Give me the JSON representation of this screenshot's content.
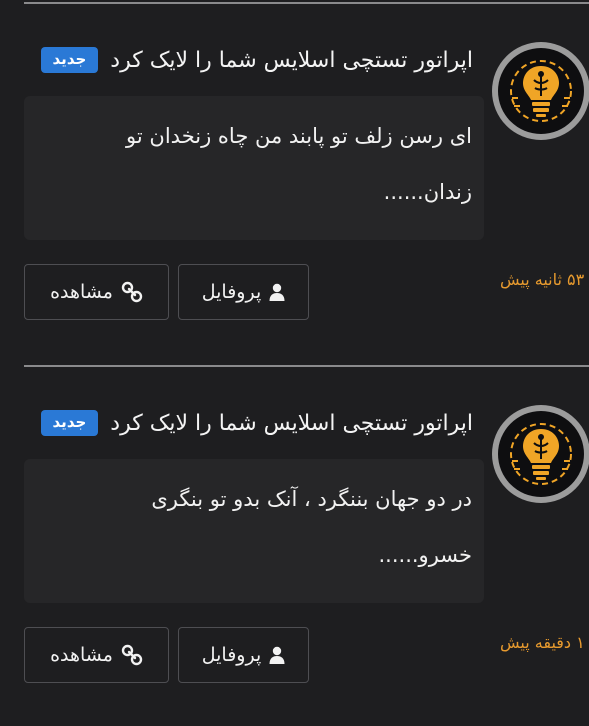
{
  "notifications": [
    {
      "title": "اپراتور تستچی اسلایس شما را لایک کرد",
      "badge": "جدید",
      "message_line1": "ای رسن زلف تو پابند من چاه زنخدان تو",
      "message_line2": "زندان......",
      "time": "۵۳ ثانیه پیش",
      "profile_label": "پروفایل",
      "view_label": "مشاهده",
      "avatar_icon": "lightbulb-brain-icon"
    },
    {
      "title": "اپراتور تستچی اسلایس شما را لایک کرد",
      "badge": "جدید",
      "message_line1": "در دو جهان بننگرد ، آنک بدو تو بنگری",
      "message_line2": "خسرو......",
      "time": "۱ دقیقه پیش",
      "profile_label": "پروفایل",
      "view_label": "مشاهده",
      "avatar_icon": "lightbulb-brain-icon"
    }
  ],
  "colors": {
    "background": "#1e1e20",
    "badge": "#2a79d6",
    "time": "#e79a2e",
    "avatar_accent": "#f0a526"
  }
}
